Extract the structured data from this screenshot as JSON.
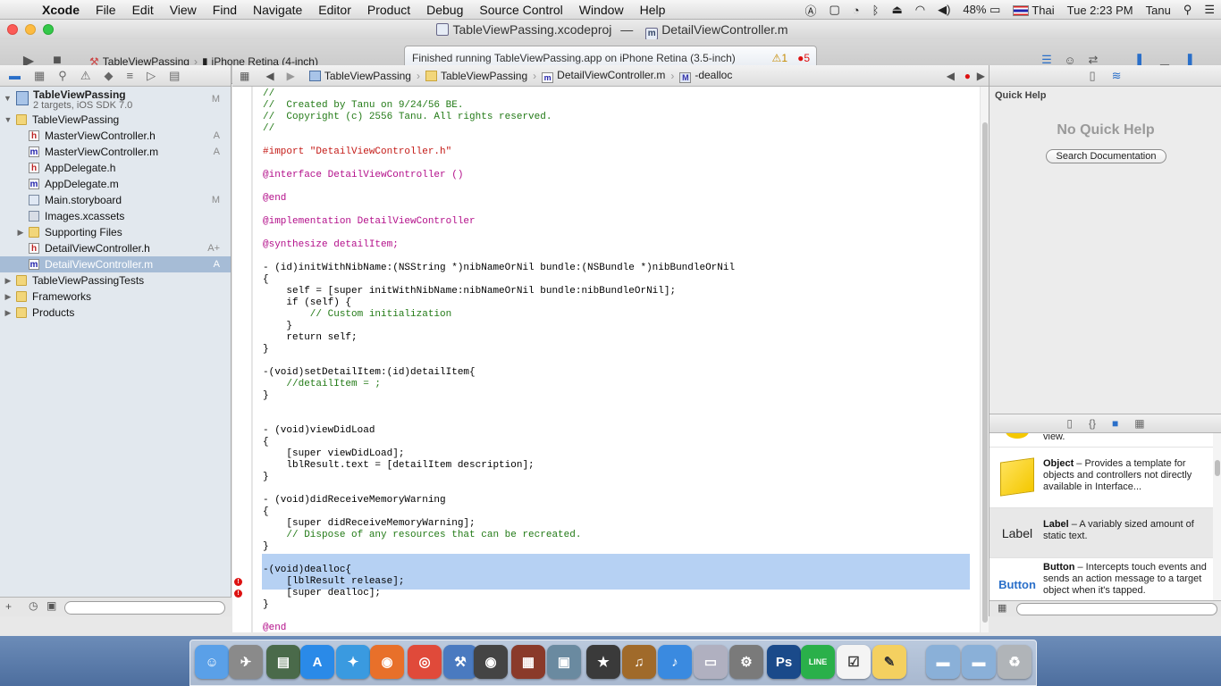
{
  "menubar": {
    "app": "Xcode",
    "items": [
      "File",
      "Edit",
      "View",
      "Find",
      "Navigate",
      "Editor",
      "Product",
      "Debug",
      "Source Control",
      "Window",
      "Help"
    ],
    "battery": "48%",
    "input_source": "Thai",
    "clock": "Tue 2:23 PM",
    "user": "Tanu"
  },
  "window": {
    "title_project": "TableViewPassing.xcodeproj",
    "title_sep": "—",
    "title_file": "DetailViewController.m"
  },
  "toolbar": {
    "scheme": "TableViewPassing",
    "destination": "iPhone Retina (4-inch)",
    "activity": "Finished running TableViewPassing.app on iPhone Retina (3.5-inch)",
    "warnings": "1",
    "errors": "5"
  },
  "navigator": {
    "project": {
      "name": "TableViewPassing",
      "subtitle": "2 targets, iOS SDK 7.0",
      "badge": "M"
    },
    "items": [
      {
        "label": "TableViewPassing",
        "kind": "folder",
        "level": 1,
        "disclosure": "open",
        "badge": ""
      },
      {
        "label": "MasterViewController.h",
        "kind": "h",
        "level": 2,
        "badge": "A"
      },
      {
        "label": "MasterViewController.m",
        "kind": "m",
        "level": 2,
        "badge": "A"
      },
      {
        "label": "AppDelegate.h",
        "kind": "h",
        "level": 2,
        "badge": ""
      },
      {
        "label": "AppDelegate.m",
        "kind": "m",
        "level": 2,
        "badge": ""
      },
      {
        "label": "Main.storyboard",
        "kind": "sb",
        "level": 2,
        "badge": "M"
      },
      {
        "label": "Images.xcassets",
        "kind": "xc",
        "level": 2,
        "badge": ""
      },
      {
        "label": "Supporting Files",
        "kind": "folder",
        "level": 2,
        "disclosure": "closed",
        "badge": ""
      },
      {
        "label": "DetailViewController.h",
        "kind": "h",
        "level": 2,
        "badge": "A+"
      },
      {
        "label": "DetailViewController.m",
        "kind": "m",
        "level": 2,
        "badge": "A",
        "selected": true
      },
      {
        "label": "TableViewPassingTests",
        "kind": "folder",
        "level": 1,
        "disclosure": "closed",
        "badge": ""
      },
      {
        "label": "Frameworks",
        "kind": "folder",
        "level": 1,
        "disclosure": "closed",
        "badge": ""
      },
      {
        "label": "Products",
        "kind": "folder",
        "level": 1,
        "disclosure": "closed",
        "badge": ""
      }
    ]
  },
  "jumpbar": {
    "crumbs": [
      "TableViewPassing",
      "TableViewPassing",
      "DetailViewController.m",
      "-dealloc"
    ]
  },
  "code_lines": [
    {
      "t": "//",
      "c": "cm"
    },
    {
      "t": "//  Created by Tanu on 9/24/56 BE.",
      "c": "cm"
    },
    {
      "t": "//  Copyright (c) 2556 Tanu. All rights reserved.",
      "c": "cm"
    },
    {
      "t": "//",
      "c": "cm"
    },
    {
      "t": "",
      "c": ""
    },
    {
      "t": "#import \"DetailViewController.h\"",
      "c": "str"
    },
    {
      "t": "",
      "c": ""
    },
    {
      "t": "@interface DetailViewController ()",
      "c": "kw"
    },
    {
      "t": "",
      "c": ""
    },
    {
      "t": "@end",
      "c": "kw"
    },
    {
      "t": "",
      "c": ""
    },
    {
      "t": "@implementation DetailViewController",
      "c": "kw"
    },
    {
      "t": "",
      "c": ""
    },
    {
      "t": "@synthesize detailItem;",
      "c": "kw"
    },
    {
      "t": "",
      "c": ""
    },
    {
      "t": "- (id)initWithNibName:(NSString *)nibNameOrNil bundle:(NSBundle *)nibBundleOrNil",
      "c": ""
    },
    {
      "t": "{",
      "c": ""
    },
    {
      "t": "    self = [super initWithNibName:nibNameOrNil bundle:nibBundleOrNil];",
      "c": ""
    },
    {
      "t": "    if (self) {",
      "c": ""
    },
    {
      "t": "        // Custom initialization",
      "c": "cm"
    },
    {
      "t": "    }",
      "c": ""
    },
    {
      "t": "    return self;",
      "c": ""
    },
    {
      "t": "}",
      "c": ""
    },
    {
      "t": "",
      "c": ""
    },
    {
      "t": "-(void)setDetailItem:(id)detailItem{",
      "c": ""
    },
    {
      "t": "    //detailItem = ;",
      "c": "cm"
    },
    {
      "t": "}",
      "c": ""
    },
    {
      "t": "",
      "c": ""
    },
    {
      "t": "",
      "c": ""
    },
    {
      "t": "- (void)viewDidLoad",
      "c": ""
    },
    {
      "t": "{",
      "c": ""
    },
    {
      "t": "    [super viewDidLoad];",
      "c": ""
    },
    {
      "t": "    lblResult.text = [detailItem description];",
      "c": ""
    },
    {
      "t": "}",
      "c": ""
    },
    {
      "t": "",
      "c": ""
    },
    {
      "t": "- (void)didReceiveMemoryWarning",
      "c": ""
    },
    {
      "t": "{",
      "c": ""
    },
    {
      "t": "    [super didReceiveMemoryWarning];",
      "c": ""
    },
    {
      "t": "    // Dispose of any resources that can be recreated.",
      "c": "cm"
    },
    {
      "t": "}",
      "c": ""
    },
    {
      "t": "",
      "c": ""
    },
    {
      "t": "-(void)dealloc{",
      "c": ""
    },
    {
      "t": "    [lblResult release];",
      "c": "",
      "error": true
    },
    {
      "t": "    [super dealloc];",
      "c": "",
      "error": true
    },
    {
      "t": "}",
      "c": ""
    },
    {
      "t": "",
      "c": ""
    },
    {
      "t": "@end",
      "c": "kw"
    }
  ],
  "quick_help": {
    "title": "Quick Help",
    "empty": "No Quick Help",
    "button": "Search Documentation"
  },
  "library": {
    "top_fragment": "view.",
    "items": [
      {
        "name": "Object",
        "desc": " – Provides a template for objects and controllers not directly available in Interface...",
        "icon": "cube"
      },
      {
        "name": "Label",
        "desc": " – A variably sized amount of static text.",
        "icon": "Label"
      },
      {
        "name": "Button",
        "desc": " – Intercepts touch events and sends an action message to a target object when it's tapped.",
        "icon": "Button"
      }
    ]
  },
  "colors": {
    "selection": "#b6d1f3",
    "keyword": "#b30f8a",
    "comment": "#227a16",
    "string": "#c41a16",
    "error": "#dd1111"
  }
}
